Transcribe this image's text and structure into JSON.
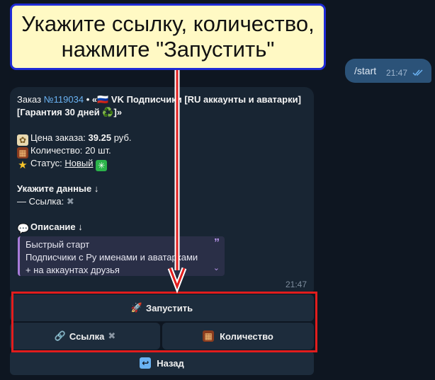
{
  "annotation": {
    "line1": "Укажите ссылку, количество,",
    "line2": "нажмите \"Запустить\""
  },
  "outgoing_message": {
    "text": "/start",
    "time": "21:47"
  },
  "bot_message": {
    "order_prefix": "Заказ ",
    "order_number": "№119034",
    "order_title_1": " • «🇷🇺 VK Подписчики [RU аккаунты и аватарки]",
    "order_title_2": "[Гарантия 30 дней ♻️]»",
    "price_label": "Цена заказа:",
    "price_value": "39.25",
    "price_unit": "руб.",
    "quantity_label": "Количество:",
    "quantity_value": "20 шт.",
    "status_label": "Статус:",
    "status_value": "Новый",
    "data_heading": "Укажите данные ↓",
    "link_label": "— Ссылка:",
    "description_heading": "Описание ↓",
    "description_lines": [
      "Быстрый старт",
      "Подписчики с Ру именами и аватарками",
      "+ на аккаунтах друзья"
    ],
    "time": "21:47"
  },
  "keyboard": {
    "launch": "Запустить",
    "link": "Ссылка",
    "quantity": "Количество",
    "back": "Назад"
  },
  "colors": {
    "background": "#0e1621",
    "bubble_in": "#182533",
    "bubble_out": "#2b5278",
    "link": "#6ab2f2",
    "highlight": "#e21d1d",
    "callout_bg": "#fff9c4",
    "callout_border": "#1f2bd6"
  }
}
